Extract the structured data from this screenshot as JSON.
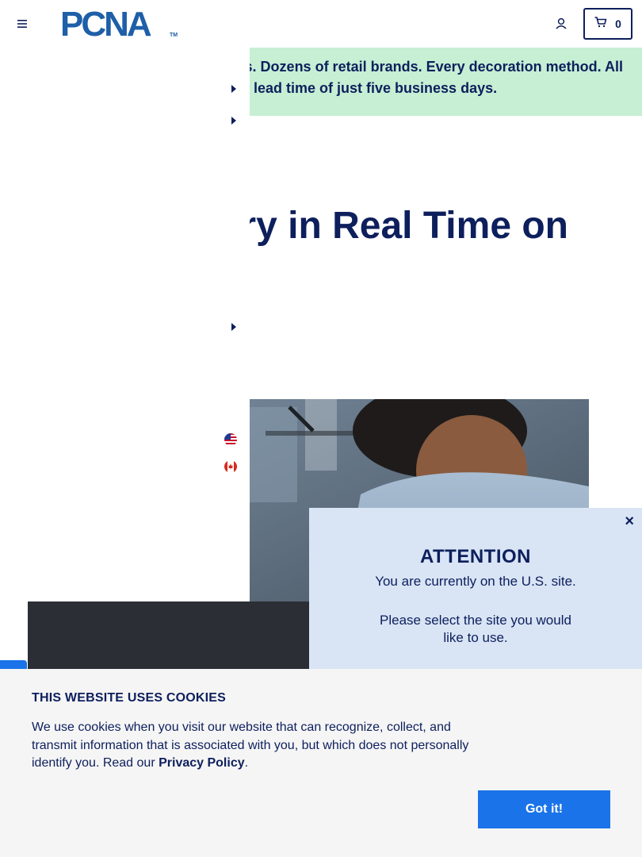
{
  "header": {
    "menu_icon": "hamburger-icon",
    "logo_text": "PCNA",
    "logo_tm": "TM",
    "account_icon": "user-icon",
    "cart_icon": "cart-icon",
    "cart_count": "0"
  },
  "promo": {
    "line1": "s. Dozens of retail brands. Every decoration method. All",
    "line2": "lead time of just five business days."
  },
  "headline": "ry in Real Time on",
  "side_panel": {
    "caret_icon": "caret-right-icon",
    "flags": [
      "us-flag-icon",
      "canada-flag-icon"
    ]
  },
  "modal": {
    "close": "×",
    "title": "ATTENTION",
    "line1": "You are currently on the U.S. site.",
    "line2": "Please select the site you would",
    "line3": "like to use."
  },
  "cookie": {
    "title": "THIS WEBSITE USES COOKIES",
    "text": "We use cookies when you visit our website that can recognize, collect, and transmit information that is associated with you, but which does not personally identify you. Read our ",
    "link": "Privacy Policy",
    "period": ".",
    "button": "Got it!"
  },
  "colors": {
    "navy": "#0d1f5c",
    "brand_blue": "#1e5fa8",
    "promo_green": "#c6efd4",
    "modal_blue": "#d9e4f5",
    "button_blue": "#1a73e8"
  }
}
